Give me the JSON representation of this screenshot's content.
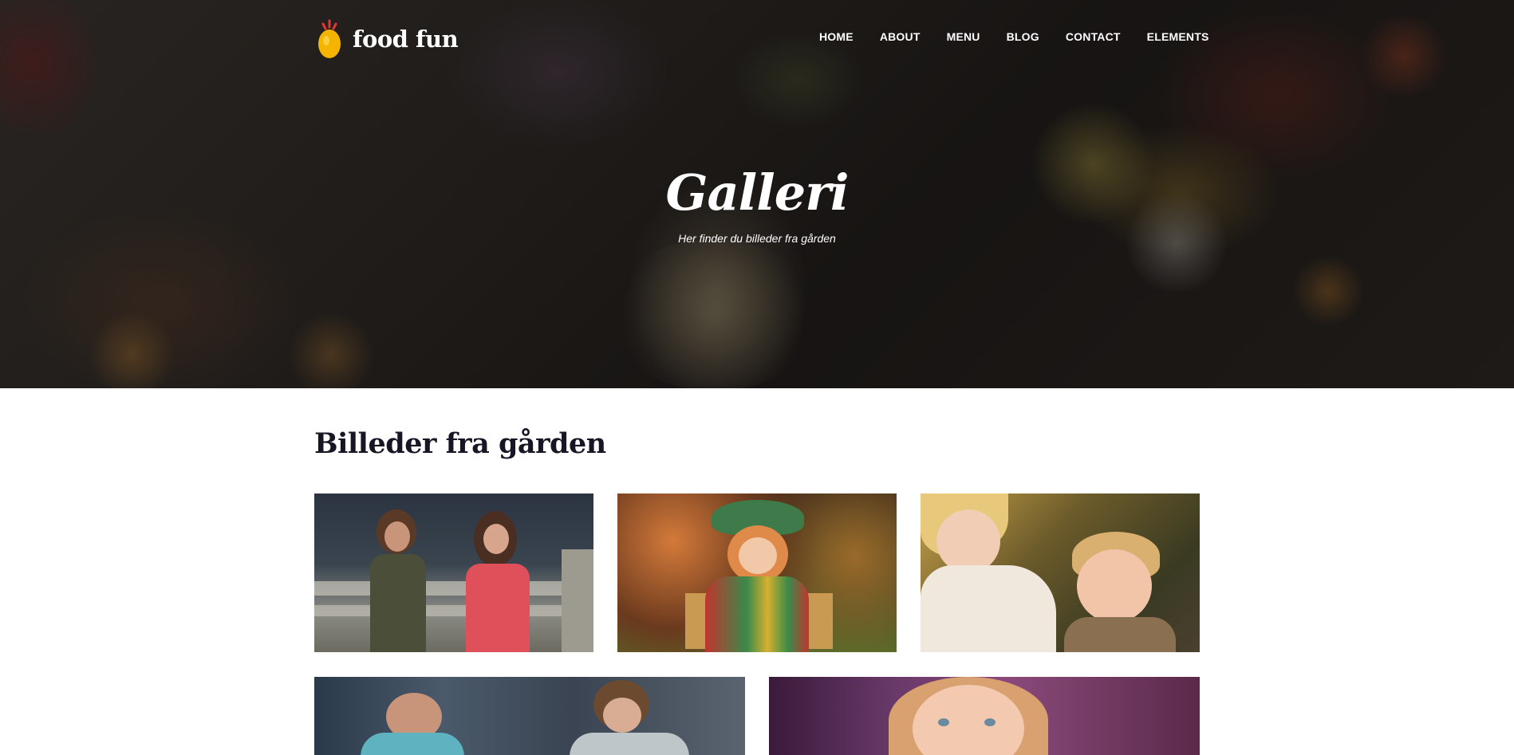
{
  "brand": {
    "name": "food fun",
    "logo_icon": "egg-chick-icon"
  },
  "nav": {
    "items": [
      "HOME",
      "ABOUT",
      "MENU",
      "BLOG",
      "CONTACT",
      "ELEMENTS"
    ]
  },
  "hero": {
    "title": "Galleri",
    "subtitle": "Her finder du billeder fra gården",
    "background": "dark food table photo"
  },
  "gallery": {
    "heading": "Billeder fra gården",
    "photos": [
      {
        "subject": "two children standing by fence"
      },
      {
        "subject": "clown doll on bench"
      },
      {
        "subject": "girl and boy in autumn"
      },
      {
        "subject": "two children playing"
      },
      {
        "subject": "smiling girl portrait"
      }
    ]
  },
  "colors": {
    "heading": "#161625",
    "accent": "#f4b400",
    "nav_text": "#ffffff"
  }
}
